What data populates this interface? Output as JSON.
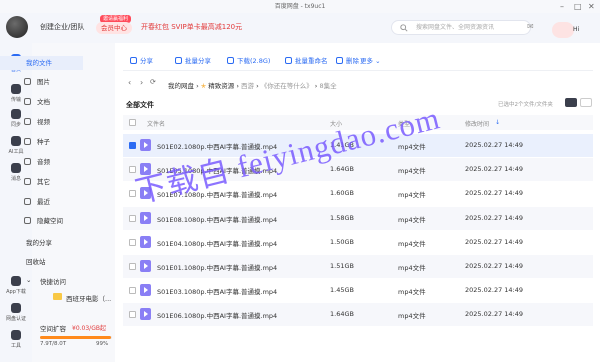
{
  "window": {
    "title": "百度网盘 - tx9uc1"
  },
  "header": {
    "org": "创建企业/团队",
    "vip_badge": "邀请赢福利",
    "vip_button": "会员中心",
    "promo": "开春红包 SVIP单卡最高减120元",
    "search_placeholder": "搜索网盘文件、全网资源资讯",
    "user": "Hi"
  },
  "rail": [
    {
      "label": "首页"
    },
    {
      "label": "传输"
    },
    {
      "label": "同步"
    },
    {
      "label": "AI工具"
    },
    {
      "label": "消息"
    },
    {
      "label": "App下载"
    },
    {
      "label": "网盘认证"
    },
    {
      "label": "工具"
    }
  ],
  "sidebar": {
    "my_files": "我的文件",
    "items": [
      "图片",
      "文档",
      "视频",
      "种子",
      "音频",
      "其它",
      "最近",
      "隐藏空间"
    ],
    "share": "我的分享",
    "recycle": "回收站",
    "quick": "快捷访问",
    "quick_item": "西班牙电影（...",
    "storage_label": "空间扩容",
    "expand": "¥0.03/GB起",
    "quota": "7.9T/8.0T",
    "percent": "99%",
    "usage_fraction": 0.99
  },
  "toolbar": [
    "分享",
    "批量分享",
    "下载(2.8G)",
    "批量重命名",
    "删除",
    "更多"
  ],
  "breadcrumb": {
    "root": "我的网盘",
    "star": "✭",
    "item1": "精致资源",
    "item2": "西游",
    "item3": "《你还在等什么》",
    "item4": "8集全"
  },
  "list": {
    "title": "全部文件",
    "loaded": "已选中2个文件/文件夹",
    "columns": {
      "name": "文件名",
      "size": "大小",
      "type": "类型",
      "modified": "修改时间"
    },
    "rows": [
      {
        "name": "S01E02.1080p.中西AI字幕.普通摸.mp4",
        "size": "1.41GB",
        "type": "mp4文件",
        "modified": "2025.02.27 14:49",
        "selected": true
      },
      {
        "name": "S01E05.1080p.中西AI字幕.普通摸.mp4",
        "size": "1.64GB",
        "type": "mp4文件",
        "modified": "2025.02.27 14:49",
        "selected": false
      },
      {
        "name": "S01E07.1080p.中西AI字幕.普通摸.mp4",
        "size": "1.60GB",
        "type": "mp4文件",
        "modified": "2025.02.27 14:49",
        "selected": false
      },
      {
        "name": "S01E08.1080p.中西AI字幕.普通摸.mp4",
        "size": "1.58GB",
        "type": "mp4文件",
        "modified": "2025.02.27 14:49",
        "selected": false
      },
      {
        "name": "S01E04.1080p.中西AI字幕.普通摸.mp4",
        "size": "1.50GB",
        "type": "mp4文件",
        "modified": "2025.02.27 14:49",
        "selected": false
      },
      {
        "name": "S01E01.1080p.中西AI字幕.普通摸.mp4",
        "size": "1.51GB",
        "type": "mp4文件",
        "modified": "2025.02.27 14:49",
        "selected": false
      },
      {
        "name": "S01E03.1080p.中西AI字幕.普通摸.mp4",
        "size": "1.45GB",
        "type": "mp4文件",
        "modified": "2025.02.27 14:49",
        "selected": false
      },
      {
        "name": "S01E06.1080p.中西AI字幕.普通摸.mp4",
        "size": "1.64GB",
        "type": "mp4文件",
        "modified": "2025.02.27 14:49",
        "selected": false
      }
    ]
  },
  "watermark": "下载自 feiyingdao.com",
  "colors": {
    "accent": "#2b6bf3",
    "file_icon": "#8a7ff5",
    "watermark": "#7a5cff"
  }
}
